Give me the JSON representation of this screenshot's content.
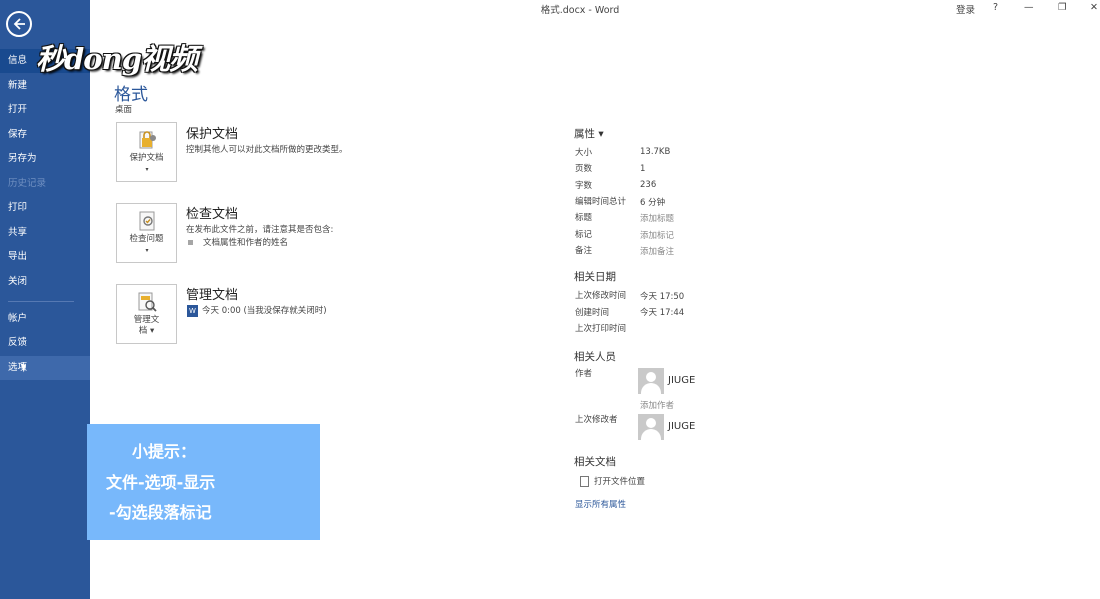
{
  "window": {
    "title": "格式.docx - Word",
    "signin": "登录",
    "help": "?",
    "minimize": "—",
    "restore": "❐",
    "close": "✕"
  },
  "logo": {
    "text": "秒dong视频"
  },
  "sidebar": {
    "items": [
      {
        "label": "信息"
      },
      {
        "label": "新建"
      },
      {
        "label": "打开"
      },
      {
        "label": "保存"
      },
      {
        "label": "另存为"
      },
      {
        "label": "历史记录"
      },
      {
        "label": "打印"
      },
      {
        "label": "共享"
      },
      {
        "label": "导出"
      },
      {
        "label": "关闭"
      },
      {
        "label": "帐户"
      },
      {
        "label": "反馈"
      },
      {
        "label": "选项"
      }
    ]
  },
  "main": {
    "title": "格式",
    "location": "桌面",
    "protect": {
      "button_label": "保护文档",
      "title": "保护文档",
      "desc": "控制其他人可以对此文档所做的更改类型。"
    },
    "inspect": {
      "button_label": "检查问题",
      "title": "检查文档",
      "desc": "在发布此文件之前，请注意其是否包含:",
      "bullet": "文档属性和作者的姓名"
    },
    "manage": {
      "button_label_1": "管理文",
      "button_label_2": "档",
      "title": "管理文档",
      "entry": "今天 0:00 (当我没保存就关闭时)"
    }
  },
  "properties": {
    "header": "属性 ▾",
    "rows": [
      {
        "label": "大小",
        "value": "13.7KB"
      },
      {
        "label": "页数",
        "value": "1"
      },
      {
        "label": "字数",
        "value": "236"
      },
      {
        "label": "编辑时间总计",
        "value": "6 分钟"
      },
      {
        "label": "标题",
        "value": "添加标题"
      },
      {
        "label": "标记",
        "value": "添加标记"
      },
      {
        "label": "备注",
        "value": "添加备注"
      }
    ],
    "dates_header": "相关日期",
    "dates": [
      {
        "label": "上次修改时间",
        "value": "今天 17:50"
      },
      {
        "label": "创建时间",
        "value": "今天 17:44"
      },
      {
        "label": "上次打印时间",
        "value": ""
      }
    ],
    "people_header": "相关人员",
    "author_label": "作者",
    "author_name": "JIUGE",
    "add_author": "添加作者",
    "modifier_label": "上次修改者",
    "modifier_name": "JIUGE",
    "docs_header": "相关文档",
    "open_location": "打开文件位置",
    "show_all": "显示所有属性"
  },
  "tip": {
    "line1": "小提示：",
    "line2": "文件-选项-显示",
    "line3": "-勾选段落标记"
  }
}
